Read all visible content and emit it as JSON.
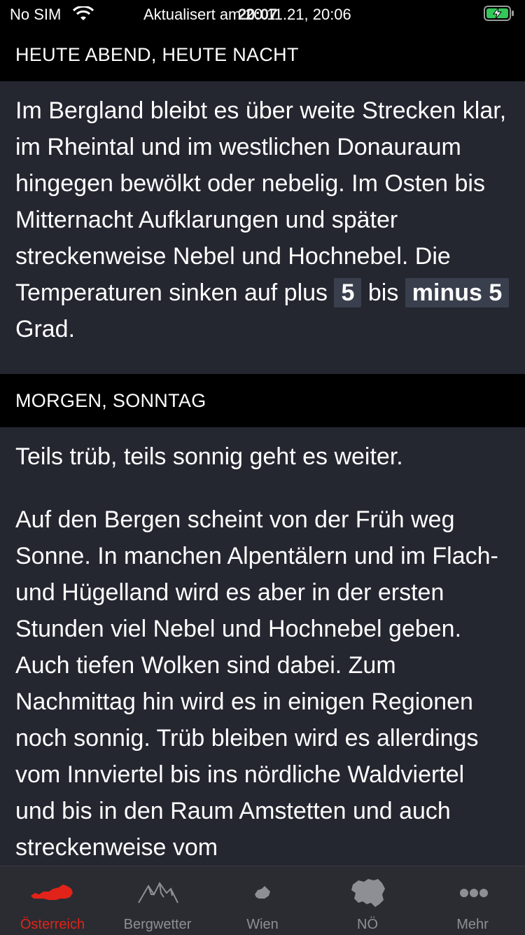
{
  "status_bar": {
    "carrier": "No SIM",
    "time": "20:07",
    "updated_text": "Aktualisert am 20.11.21, 20:06"
  },
  "sections": [
    {
      "header": "HEUTE ABEND, HEUTE NACHT",
      "text_before": "Im Bergland bleibt es über weite Strecken klar, im Rheintal und im westlichen Donauraum hingegen bewölkt oder nebelig. Im Osten bis Mitternacht Aufklarungen und später streckenweise Nebel und Hochnebel. Die Temperaturen sinken auf plus ",
      "temp_high": "5",
      "text_between": " bis ",
      "temp_low": "minus 5",
      "text_after": " Grad."
    },
    {
      "header": "MORGEN, SONNTAG",
      "paragraph_1": "Teils trüb, teils sonnig geht es weiter.",
      "paragraph_2": "Auf den Bergen scheint von der Früh weg Sonne. In manchen Alpentälern und im Flach- und Hügelland wird es aber in der ersten Stunden viel Nebel und Hochnebel geben. Auch tiefen Wolken sind dabei. Zum Nachmittag hin wird es in einigen Regionen noch sonnig. Trüb bleiben wird es allerdings vom Innviertel bis ins nördliche Waldviertel und bis in den Raum Amstetten und auch streckenweise vom"
    }
  ],
  "tab_bar": {
    "tabs": [
      {
        "label": "Österreich",
        "icon": "austria-map-icon",
        "active": true
      },
      {
        "label": "Bergwetter",
        "icon": "mountains-icon",
        "active": false
      },
      {
        "label": "Wien",
        "icon": "vienna-map-icon",
        "active": false
      },
      {
        "label": "NÖ",
        "icon": "lower-austria-map-icon",
        "active": false
      },
      {
        "label": "Mehr",
        "icon": "more-dots-icon",
        "active": false
      }
    ]
  },
  "colors": {
    "background": "#242630",
    "header_background": "#000000",
    "highlight_background": "#3a3f4d",
    "accent": "#e2231a",
    "tab_inactive": "#8e8f94"
  }
}
